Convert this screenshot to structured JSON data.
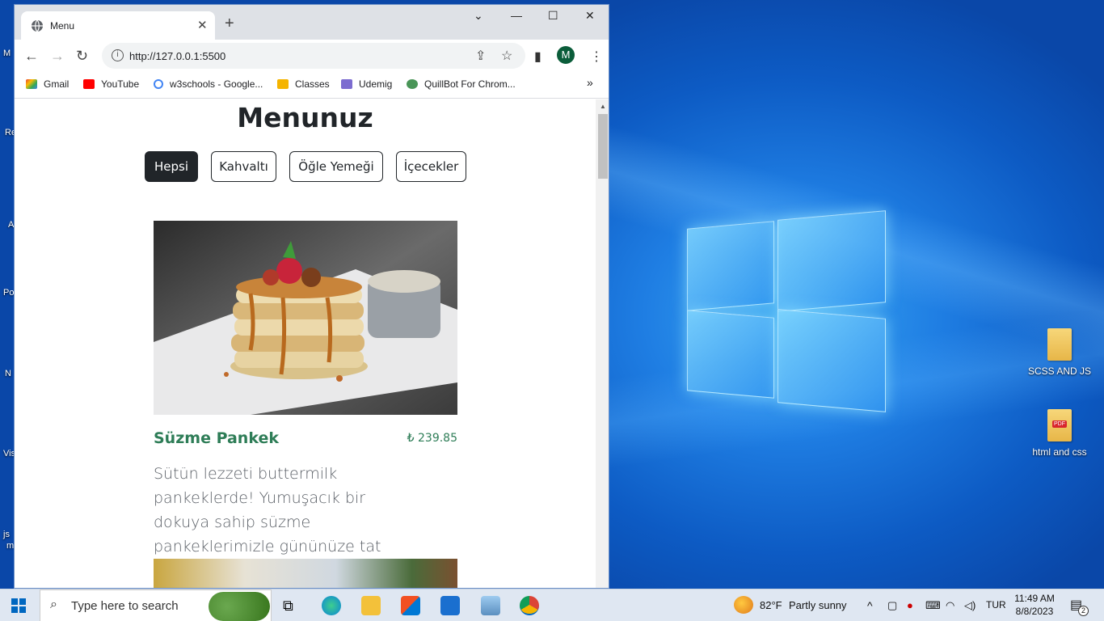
{
  "desktop": {
    "icons": [
      {
        "label": "SCSS AND JS",
        "type": "folder"
      },
      {
        "label": "html and css",
        "type": "pdf-folder"
      }
    ],
    "left_clipped_labels": [
      "M",
      "Re",
      "A",
      "Po",
      "N",
      "Vis",
      "js",
      "m"
    ]
  },
  "browser": {
    "tab_title": "Menu",
    "url": "http://127.0.0.1:5500",
    "profile_initial": "M",
    "bookmarks": [
      "Gmail",
      "YouTube",
      "w3schools - Google...",
      "Classes",
      "Udemig",
      "QuillBot For Chrom..."
    ],
    "bookmarks_overflow": "»"
  },
  "page": {
    "title": "Menunuz",
    "filters": [
      {
        "label": "Hepsi",
        "active": true
      },
      {
        "label": "Kahvaltı",
        "active": false
      },
      {
        "label": "Öğle Yemeği",
        "active": false
      },
      {
        "label": "İçecekler",
        "active": false
      }
    ],
    "items": [
      {
        "name": "Süzme Pankek",
        "price": "₺ 239.85",
        "description": "Sütün lezzeti buttermilk pankeklerde! Yumuşacık bir dokuya sahip süzme pankeklerimizle gününüze tat katın."
      }
    ]
  },
  "taskbar": {
    "search_placeholder": "Type here to search",
    "weather_temp": "82°F",
    "weather_text": "Partly sunny",
    "language": "TUR",
    "time": "11:49 AM",
    "date": "8/8/2023",
    "notification_count": "2"
  },
  "colors": {
    "accent_green": "#2e7d57",
    "dark_button": "#212529",
    "desktop_blue": "#1f7ee3"
  }
}
